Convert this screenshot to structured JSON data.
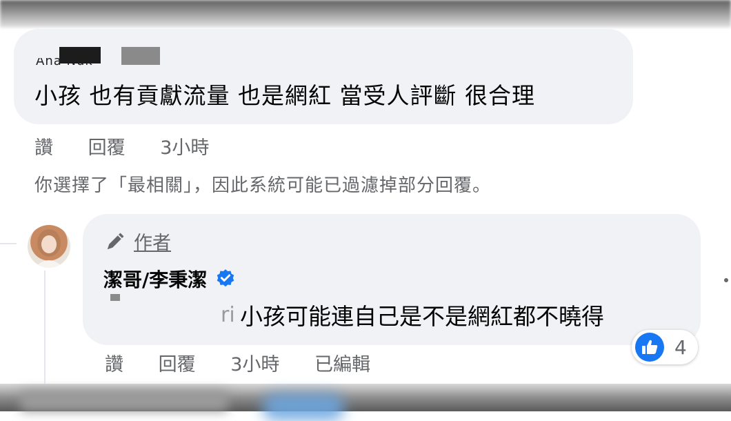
{
  "comment1": {
    "author_fragment": "Ana Nuk",
    "text": "小孩 也有貢獻流量 也是網紅 當受人評斷 很合理",
    "actions": {
      "like": "讚",
      "reply": "回覆",
      "time": "3小時"
    }
  },
  "filter_notice": "你選擇了「最相關」，因此系統可能已過濾掉部分回覆。",
  "reply": {
    "author_badge": "作者",
    "author_name": "潔哥/李秉潔",
    "tag_fragment": "ri",
    "text": "小孩可能連自己是不是網紅都不曉得",
    "reaction_count": "4",
    "actions": {
      "like": "讚",
      "reply": "回覆",
      "time": "3小時",
      "edited": "已編輯"
    }
  },
  "icons": [
    "pencil-icon",
    "verified-badge-icon",
    "like-reaction-icon",
    "more-options-icon"
  ],
  "colors": {
    "bubble": "#f0f2f5",
    "secondary_text": "#65676b",
    "facebook_blue": "#1877f2"
  }
}
